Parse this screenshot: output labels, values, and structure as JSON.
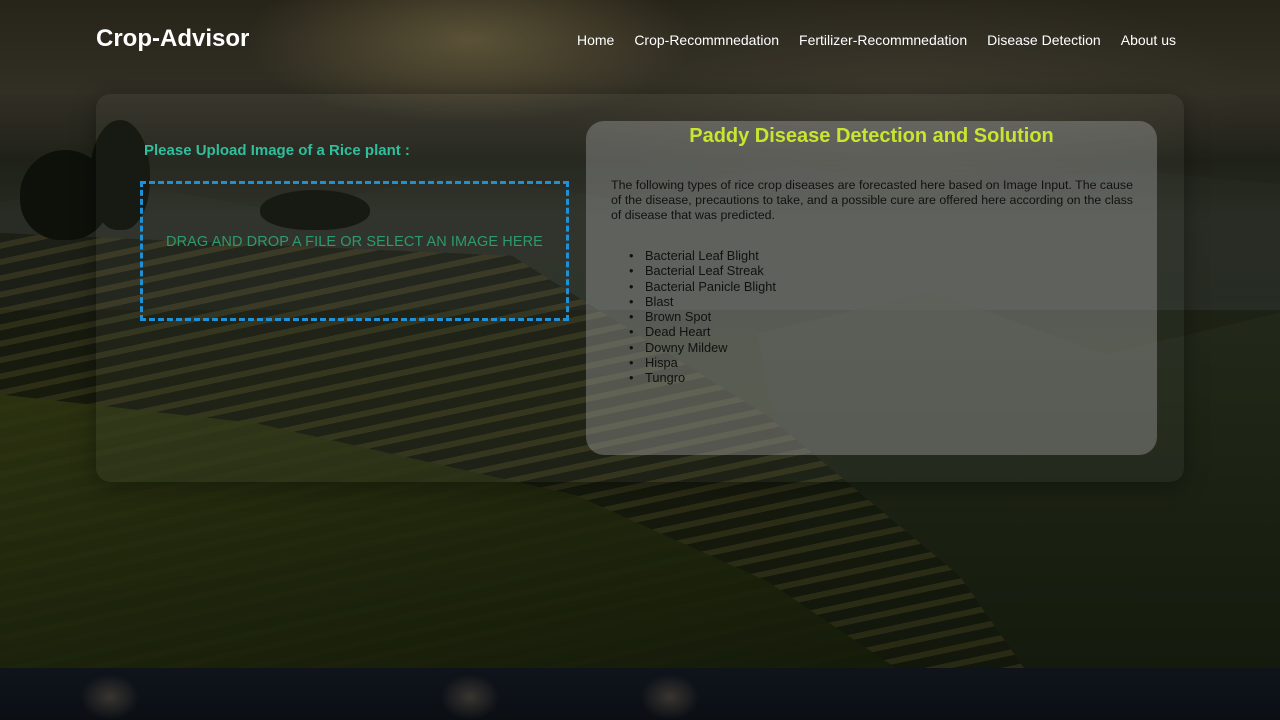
{
  "brand": "Crop-Advisor",
  "nav": {
    "items": [
      "Home",
      "Crop-Recommnedation",
      "Fertilizer-Recommnedation",
      "Disease Detection",
      "About us"
    ]
  },
  "upload": {
    "title": "Please Upload Image of a Rice plant :",
    "dropzone_text": "DRAG AND DROP A FILE OR SELECT AN IMAGE HERE"
  },
  "info": {
    "heading": "Paddy Disease Detection and Solution",
    "description": "The following types of rice crop diseases are forecasted here based on Image Input. The cause of the disease, precautions to take, and a possible cure are offered here according on the class of disease that was predicted.",
    "diseases": [
      "Bacterial Leaf Blight",
      "Bacterial Leaf Streak",
      "Bacterial Panicle Blight",
      "Blast",
      "Brown Spot",
      "Dead Heart",
      "Downy Mildew",
      "Hispa",
      "Tungro"
    ]
  },
  "colors": {
    "upload_title": "#2fbf9c",
    "dropzone_border": "#1f8fd6",
    "dropzone_text": "#2e9a6b",
    "heading": "#c8e630"
  }
}
